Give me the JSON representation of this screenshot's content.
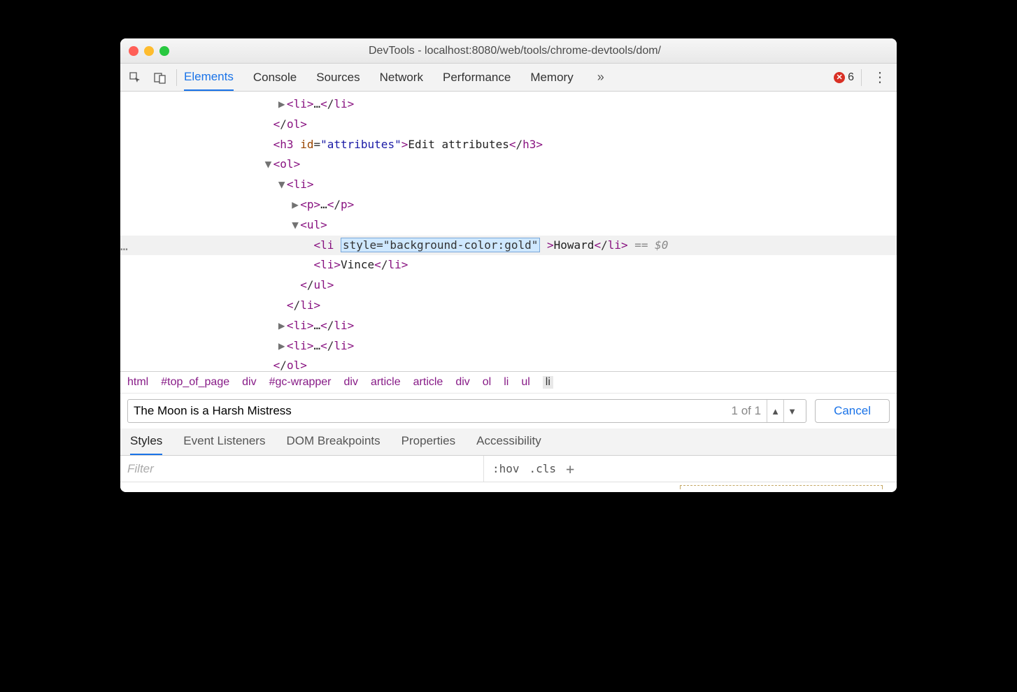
{
  "window": {
    "title": "DevTools - localhost:8080/web/tools/chrome-devtools/dom/"
  },
  "toolbar": {
    "tabs": [
      "Elements",
      "Console",
      "Sources",
      "Network",
      "Performance",
      "Memory"
    ],
    "active_tab": "Elements",
    "errors": "6"
  },
  "dom": {
    "lines": [
      {
        "indent": 11,
        "tri": "r",
        "html": "<li>…</li>"
      },
      {
        "indent": 10,
        "html": "</ol>"
      },
      {
        "indent": 10,
        "htmlparts": {
          "open": "<h3 ",
          "attr": "id",
          "eq": "=",
          "val": "\"attributes\"",
          "close": ">",
          "text": "Edit attributes",
          "end": "</h3>"
        }
      },
      {
        "indent": 10,
        "tri": "d",
        "html": "<ol>"
      },
      {
        "indent": 11,
        "tri": "d",
        "html": "<li>"
      },
      {
        "indent": 12,
        "tri": "r",
        "html": "<p>…</p>"
      },
      {
        "indent": 12,
        "tri": "d",
        "html": "<ul>"
      },
      {
        "indent": 13,
        "hl": true,
        "htmlparts": {
          "open": "<li ",
          "editbox": "style=\"background-color:gold\"",
          "mid": " >",
          "text": "Howard",
          "end": "</li>",
          "ref": " == $0"
        }
      },
      {
        "indent": 13,
        "htmlparts": {
          "open": "<li>",
          "text": "Vince",
          "end": "</li>"
        }
      },
      {
        "indent": 12,
        "html": "</ul>"
      },
      {
        "indent": 11,
        "html": "</li>"
      },
      {
        "indent": 11,
        "tri": "r",
        "html": "<li>…</li>"
      },
      {
        "indent": 11,
        "tri": "r",
        "html": "<li>…</li>"
      },
      {
        "indent": 10,
        "html": "</ol>"
      }
    ]
  },
  "breadcrumb": [
    "html",
    "#top_of_page",
    "div",
    "#gc-wrapper",
    "div",
    "article",
    "article",
    "div",
    "ol",
    "li",
    "ul",
    "li"
  ],
  "search": {
    "value": "The Moon is a Harsh Mistress",
    "count": "1 of 1",
    "cancel": "Cancel"
  },
  "subtabs": {
    "items": [
      "Styles",
      "Event Listeners",
      "DOM Breakpoints",
      "Properties",
      "Accessibility"
    ],
    "active": "Styles"
  },
  "styles": {
    "filter_placeholder": "Filter",
    "hov": ":hov",
    "cls": ".cls"
  }
}
